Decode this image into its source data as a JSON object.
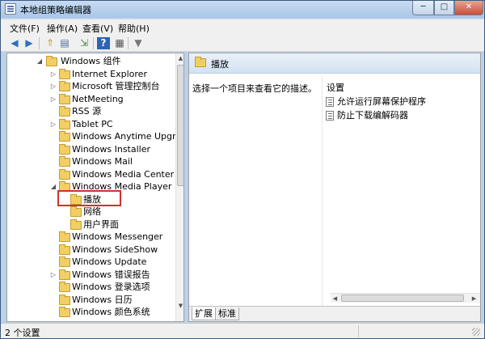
{
  "window": {
    "title": "本地组策略编辑器",
    "min_label": "─",
    "max_label": "□",
    "close_label": "✕"
  },
  "menu": [
    "文件(F)",
    "操作(A)",
    "查看(V)",
    "帮助(H)"
  ],
  "toolbar": {
    "back_icon": "◀",
    "forward_icon": "▶",
    "up_icon": "⇑",
    "show_hide_icon": "▤",
    "export_icon": "⇲",
    "help_icon": "?",
    "properties_icon": "▦",
    "filter_icon": "▼"
  },
  "tree": {
    "nodes": [
      {
        "label": "Windows 组件",
        "expander": "◢"
      },
      {
        "label": "Internet Explorer",
        "expander": "▷"
      },
      {
        "label": "Microsoft 管理控制台",
        "expander": "▷"
      },
      {
        "label": "NetMeeting",
        "expander": "▷"
      },
      {
        "label": "RSS 源",
        "expander": ""
      },
      {
        "label": "Tablet PC",
        "expander": "▷"
      },
      {
        "label": "Windows Anytime Upgrade",
        "expander": ""
      },
      {
        "label": "Windows Installer",
        "expander": ""
      },
      {
        "label": "Windows Mail",
        "expander": ""
      },
      {
        "label": "Windows Media Center",
        "expander": ""
      },
      {
        "label": "Windows Media Player",
        "expander": "◢"
      },
      {
        "label": "播放",
        "expander": ""
      },
      {
        "label": "网络",
        "expander": ""
      },
      {
        "label": "用户界面",
        "expander": ""
      },
      {
        "label": "Windows Messenger",
        "expander": ""
      },
      {
        "label": "Windows SideShow",
        "expander": ""
      },
      {
        "label": "Windows Update",
        "expander": ""
      },
      {
        "label": "Windows 错误报告",
        "expander": "▷"
      },
      {
        "label": "Windows 登录选项",
        "expander": ""
      },
      {
        "label": "Windows 日历",
        "expander": ""
      },
      {
        "label": "Windows 颜色系统",
        "expander": ""
      }
    ],
    "selected": "播放"
  },
  "right": {
    "header_title": "播放",
    "description": "选择一个项目来查看它的描述。",
    "column_header": "设置",
    "settings": [
      "允许运行屏幕保护程序",
      "防止下载编解码器"
    ]
  },
  "tabs": [
    "扩展",
    "标准"
  ],
  "status": {
    "text": "2 个设置"
  },
  "colors": {
    "highlight_box": "#d32f2f",
    "folder": "#f2cf65",
    "header_bg": "#d3e2f1"
  }
}
